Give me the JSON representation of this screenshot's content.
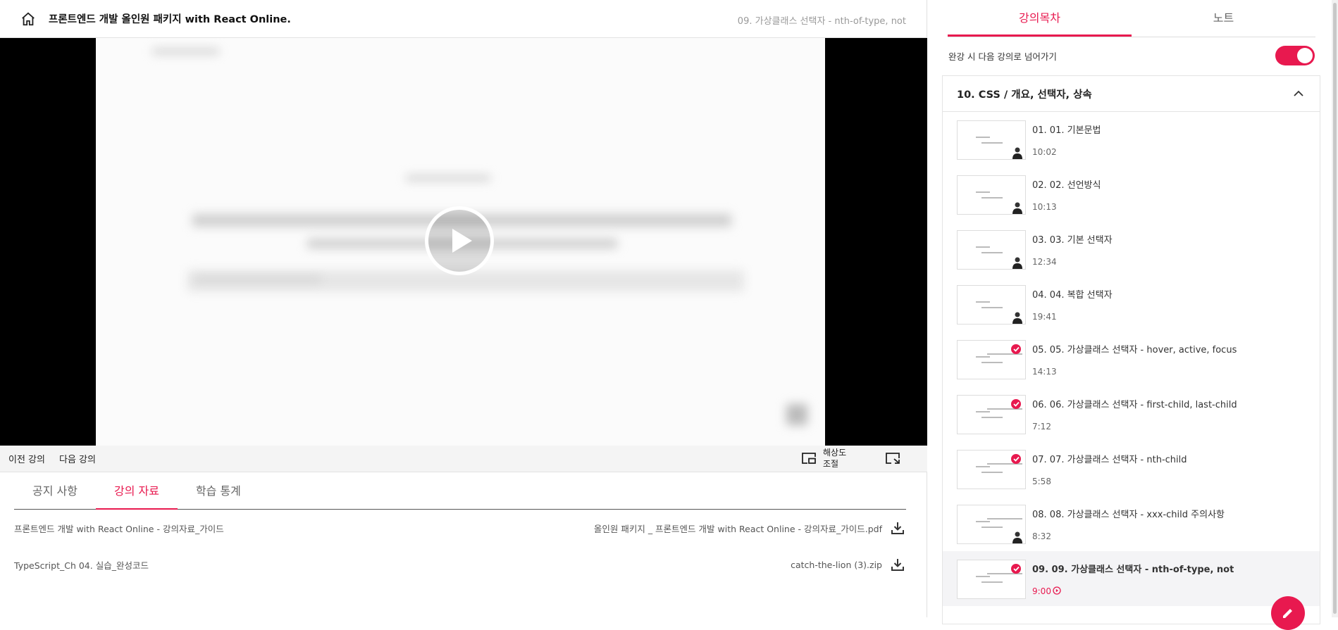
{
  "header": {
    "course_title": "프론트엔드 개발 올인원 패키지 with React Online.",
    "current_lecture": "09. 가상클래스 선택자 - nth-of-type, not",
    "home_icon": "home-icon"
  },
  "player": {
    "play_icon": "play-icon",
    "prev_label": "이전 강의",
    "next_label": "다음 강의",
    "quality_label": "해상도 조절",
    "quality_icon": "picture-in-picture-icon",
    "fullscreen_icon": "fullscreen-icon"
  },
  "tabs": [
    {
      "label": "공지 사항",
      "active": false
    },
    {
      "label": "강의 자료",
      "active": true
    },
    {
      "label": "학습 통계",
      "active": false
    }
  ],
  "materials": [
    {
      "name": "프론트엔드 개발 with React Online - 강의자료_가이드",
      "file": "올인원 패키지 _ 프론트엔드 개발 with React Online - 강의자료_가이드.pdf"
    },
    {
      "name": "TypeScript_Ch 04. 실습_완성코드",
      "file": "catch-the-lion (3).zip"
    }
  ],
  "sidebar": {
    "tabs": [
      {
        "label": "강의목차",
        "active": true
      },
      {
        "label": "노트",
        "active": false
      }
    ],
    "autoplay_label": "완강 시 다음 강의로 넘어가기",
    "autoplay_on": true,
    "section_title": "10. CSS / 개요, 선택자, 상속",
    "lectures": [
      {
        "title": "01. 01. 기본문법",
        "duration": "10:02",
        "completed": false,
        "current": false
      },
      {
        "title": "02. 02. 선언방식",
        "duration": "10:13",
        "completed": false,
        "current": false
      },
      {
        "title": "03. 03. 기본 선택자",
        "duration": "12:34",
        "completed": false,
        "current": false
      },
      {
        "title": "04. 04. 복합 선택자",
        "duration": "19:41",
        "completed": false,
        "current": false
      },
      {
        "title": "05. 05. 가상클래스 선택자 - hover, active, focus",
        "duration": "14:13",
        "completed": true,
        "current": false
      },
      {
        "title": "06. 06. 가상클래스 선택자 - first-child, last-child",
        "duration": "7:12",
        "completed": true,
        "current": false
      },
      {
        "title": "07. 07. 가상클래스 선택자 - nth-child",
        "duration": "5:58",
        "completed": true,
        "current": false
      },
      {
        "title": "08. 08. 가상클래스 선택자 - xxx-child 주의사항",
        "duration": "8:32",
        "completed": false,
        "current": false
      },
      {
        "title": "09. 09. 가상클래스 선택자 - nth-of-type, not",
        "duration": "9:00",
        "completed": true,
        "current": true
      }
    ]
  },
  "accent_color": "#e8194f"
}
